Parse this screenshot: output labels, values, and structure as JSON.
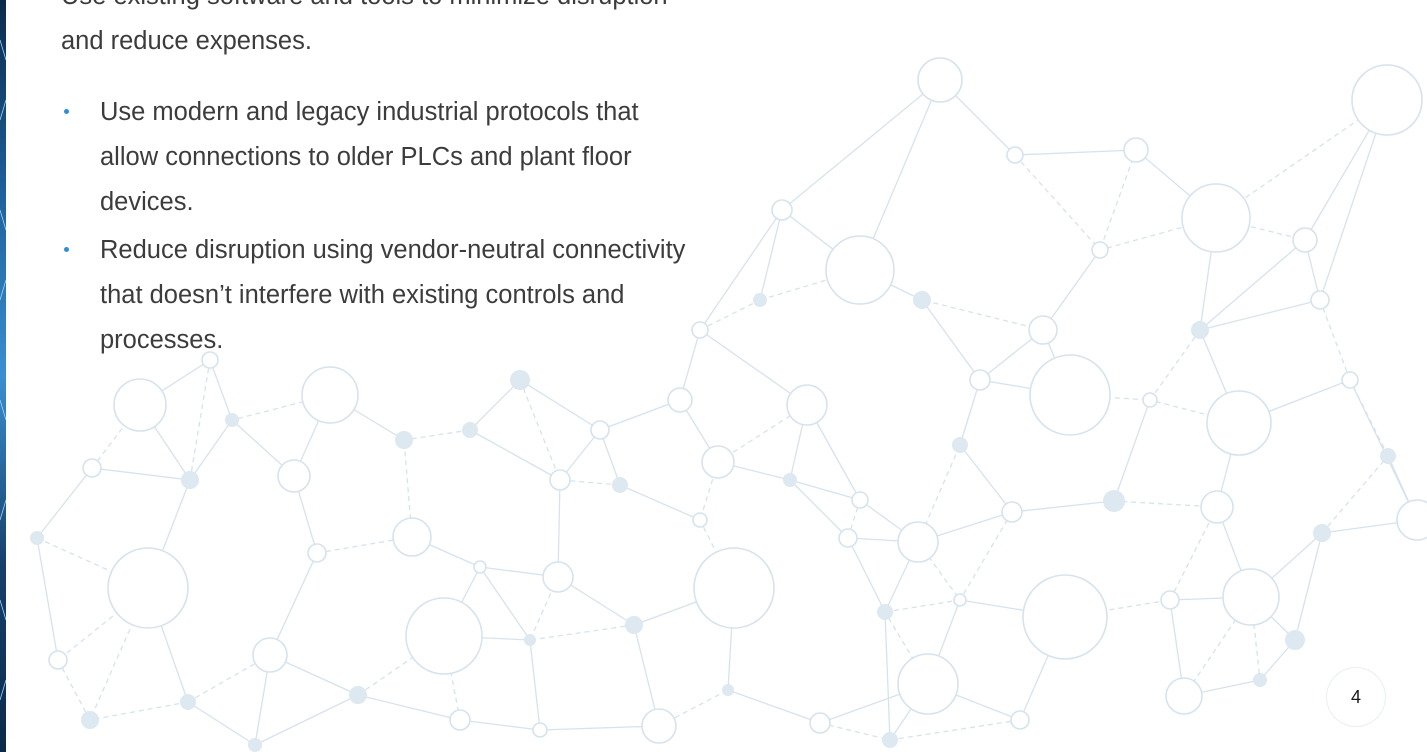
{
  "content": {
    "intro": "Use existing software and tools to minimize disruption and reduce expenses.",
    "bullets": [
      {
        "text": "Use modern and legacy industrial protocols that allow connections to older PLCs and plant floor devices."
      },
      {
        "text": "Reduce disruption using vendor-neutral connectivity that doesn’t interfere with existing controls and processes."
      }
    ]
  },
  "page_number": "4",
  "colors": {
    "text": "#3c3c3c",
    "bullet": "#2f8fd6",
    "network": "#d6e3ec",
    "edge_dark": "#0b2a4a",
    "edge_light": "#3a8fd0"
  },
  "icons": {
    "bullet": "bullet-dot-icon"
  }
}
